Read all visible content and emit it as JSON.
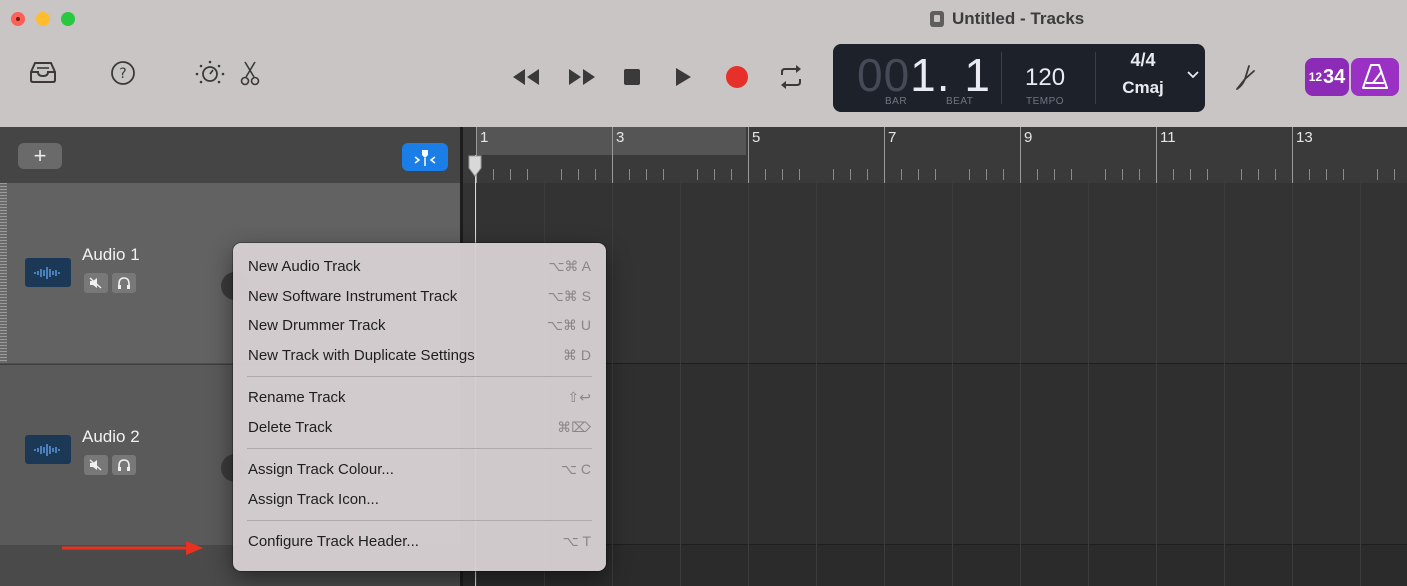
{
  "window": {
    "title": "Untitled - Tracks"
  },
  "toolbar": {
    "left_icons": [
      "library-icon",
      "help-icon",
      "smart-controls-icon",
      "editors-scissors-icon"
    ],
    "transport_icons": [
      "rewind-icon",
      "fast-forward-icon",
      "stop-icon",
      "play-icon",
      "record-icon",
      "cycle-icon"
    ],
    "right_icons": [
      "tuner-icon",
      "count-in-icon",
      "metronome-icon"
    ]
  },
  "lcd": {
    "position_dim": "00",
    "position_bright": "1. 1",
    "bar_label": "BAR",
    "beat_label": "BEAT",
    "tempo": "120",
    "tempo_label": "TEMPO",
    "time_signature": "4/4",
    "key": "Cmaj"
  },
  "count_in": {
    "small": "12",
    "large": "34"
  },
  "header": {
    "add_label": "+"
  },
  "tracks": [
    {
      "name": "Audio 1"
    },
    {
      "name": "Audio 2"
    }
  ],
  "ruler": {
    "bars": [
      "1",
      "3",
      "5",
      "7",
      "9",
      "11",
      "13"
    ]
  },
  "context_menu": {
    "items": [
      {
        "label": "New Audio Track",
        "shortcut": "⌥⌘ A"
      },
      {
        "label": "New Software Instrument Track",
        "shortcut": "⌥⌘ S"
      },
      {
        "label": "New Drummer Track",
        "shortcut": "⌥⌘ U"
      },
      {
        "label": "New Track with Duplicate Settings",
        "shortcut": "⌘ D"
      },
      {
        "label": "Rename Track",
        "shortcut": "⇧↩"
      },
      {
        "label": "Delete Track",
        "shortcut": "⌘⌦"
      },
      {
        "label": "Assign Track Colour...",
        "shortcut": "⌥ C"
      },
      {
        "label": "Assign Track Icon...",
        "shortcut": ""
      },
      {
        "label": "Configure Track Header...",
        "shortcut": "⌥ T"
      }
    ]
  },
  "colors": {
    "accent_blue": "#1a7ee6",
    "record_red": "#e8302a",
    "purple": "#8b2bb6",
    "annotation_arrow": "#e8321f"
  }
}
